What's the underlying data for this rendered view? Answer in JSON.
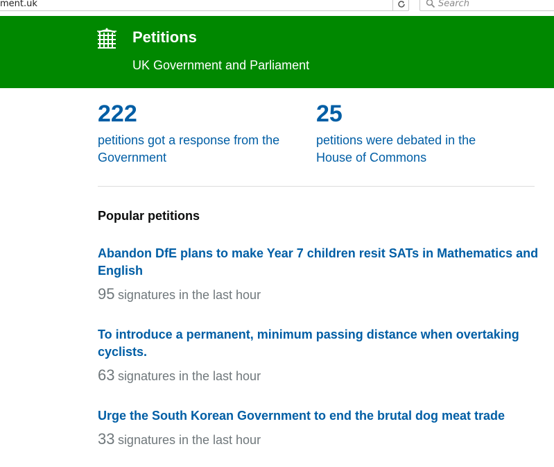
{
  "browser": {
    "url_fragment": "ment.uk",
    "search_placeholder": "Search"
  },
  "header": {
    "title": "Petitions",
    "subtitle": "UK Government and Parliament",
    "background_color": "#008800"
  },
  "stats": [
    {
      "number": "222",
      "text": "petitions got a response from the Government"
    },
    {
      "number": "25",
      "text": "petitions were debated in the House of Commons"
    }
  ],
  "popular": {
    "heading": "Popular petitions",
    "items": [
      {
        "title": "Abandon DfE plans to make Year 7 children resit SATs in Mathematics and English",
        "count": "95",
        "label": "signatures in the last hour"
      },
      {
        "title": "To introduce a permanent, minimum passing distance when overtaking cyclists.",
        "count": "63",
        "label": "signatures in the last hour"
      },
      {
        "title": "Urge the South Korean Government to end the brutal dog meat trade",
        "count": "33",
        "label": "signatures in the last hour"
      }
    ]
  },
  "colors": {
    "link": "#005ea5",
    "secondary_text": "#6f777b"
  }
}
